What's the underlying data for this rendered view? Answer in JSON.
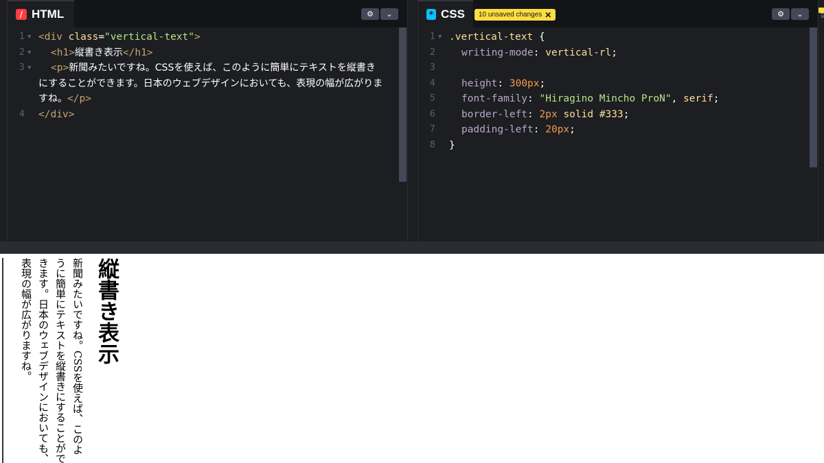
{
  "html_pane": {
    "title": "HTML",
    "icon": "html-icon",
    "icon_color": "#ff3c41",
    "lines": [
      {
        "num": "1",
        "fold": true
      },
      {
        "num": "2",
        "fold": true
      },
      {
        "num": "3",
        "fold": true
      },
      {
        "num": "4",
        "fold": false
      }
    ],
    "code": {
      "l1_open": "<div",
      "l1_attr": "class",
      "l1_eq": "=",
      "l1_val": "\"vertical-text\"",
      "l1_close": ">",
      "l2_open": "<h1>",
      "l2_text": "縦書き表示",
      "l2_close": "</h1>",
      "l3_open": "<p>",
      "l3_text": "新聞みたいですね。CSSを使えば、このように簡単にテキストを縦書きにすることができます。日本のウェブデザインにおいても、表現の幅が広がりますね。",
      "l3_close": "</p>",
      "l4": "</div>"
    }
  },
  "css_pane": {
    "title": "CSS",
    "icon": "css-icon",
    "icon_color": "#0ebeff",
    "badge": "10 unsaved changes",
    "lines": [
      "1",
      "2",
      "3",
      "4",
      "5",
      "6",
      "7",
      "8"
    ],
    "code": {
      "selector": ".vertical-text",
      "brace_open": "{",
      "p1": "writing-mode",
      "v1": "vertical-rl",
      "p2": "height",
      "v2": "300px",
      "p3": "font-family",
      "v3a": "\"Hiragino Mincho ProN\"",
      "v3b": "serif",
      "p4": "border-left",
      "v4a": "2px",
      "v4b": "solid #333",
      "p5": "padding-left",
      "v5": "20px",
      "brace_close": "}"
    }
  },
  "right_edge_label": "JS",
  "preview": {
    "heading": "縦書き表示",
    "paragraph": "新聞みたいですね。CSSを使えば、このように簡単にテキストを縦書きにすることができます。日本のウェブデザインにおいても、表現の幅が広がりますね。"
  }
}
